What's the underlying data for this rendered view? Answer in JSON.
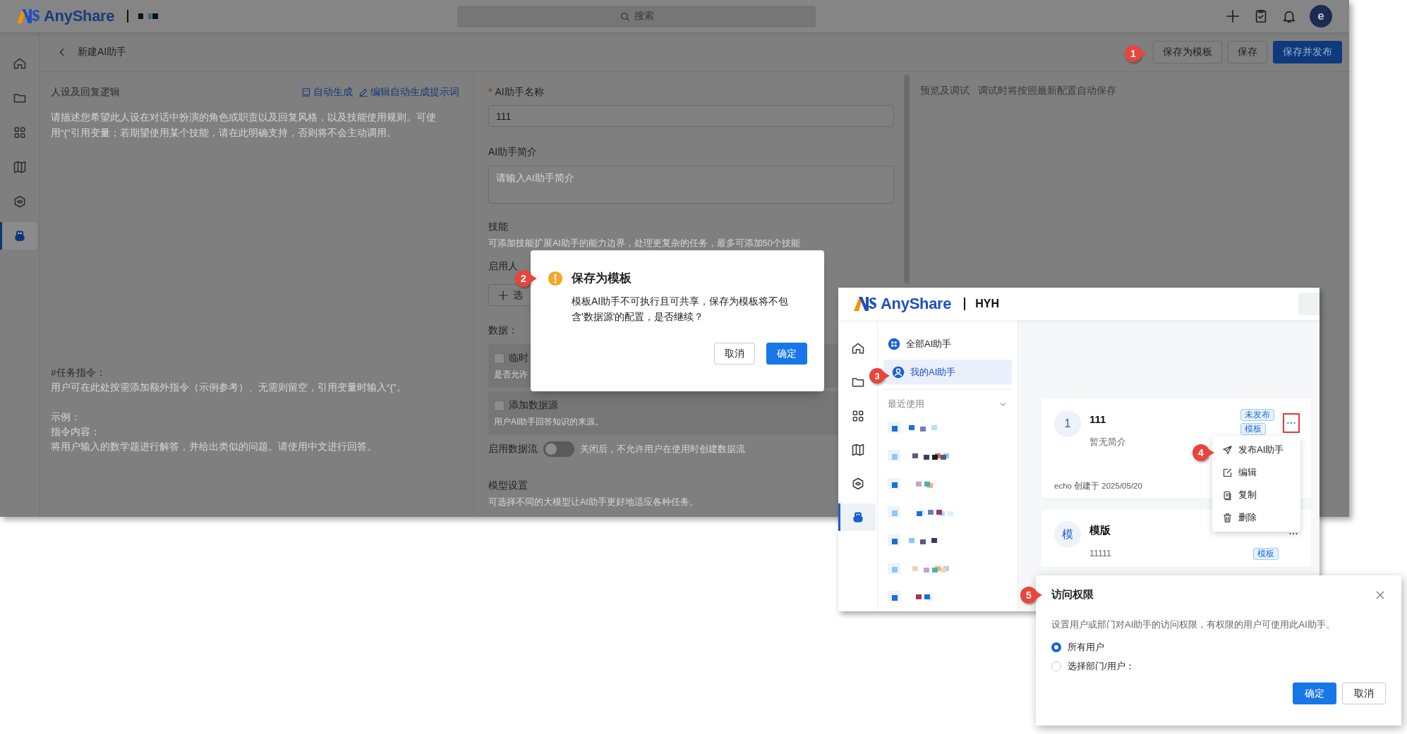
{
  "main_window": {
    "header": {
      "brand": "AnyShare",
      "search": {
        "placeholder": "搜索"
      },
      "avatar": "e"
    },
    "sidebar": [
      {
        "selected": false
      },
      {
        "selected": false
      },
      {
        "selected": false
      },
      {
        "selected": false
      },
      {
        "selected": false
      },
      {
        "selected": true
      }
    ],
    "page_title": "新建AI助手",
    "actions": [
      {
        "label": "保存为模板",
        "primary": false
      },
      {
        "label": "保存",
        "primary": false
      },
      {
        "label": "保存并发布",
        "primary": true
      }
    ],
    "persona": {
      "title": "人设及回复逻辑",
      "links": [
        "自动生成",
        "编辑自动生成提示词"
      ],
      "placeholder": "请描述您希望此人设在对话中扮演的角色或职责以及回复风格，以及技能使用规则。可使用“{”引用变量；若期望使用某个技能，请在此明确支持，否则将不会主动调用。",
      "task_lines": [
        "#任务指令：",
        "用户可在此处按需添加额外指令（示例参考）、无需则留空，引用变量时输入“{”。",
        "示例：",
        "指令内容：",
        "将用户输入的数学题进行解答，并给出类似的问题。请使用中文进行回答。"
      ]
    },
    "form": {
      "name": {
        "label": "AI助手名称",
        "required_mark": "*",
        "value": "111"
      },
      "intro": {
        "label": "AI助手简介",
        "placeholder": "请输入AI助手简介"
      },
      "skills": {
        "label": "技能",
        "hint": "可添加技能扩展AI助手的能力边界，处理更复杂的任务，最多可添加50个技能"
      },
      "human": {
        "label": "启用人",
        "button": "选"
      },
      "data": {
        "label": "数据：",
        "options": [
          {
            "label": "临时",
            "hint": "是否允许",
            "checked": false
          },
          {
            "label": "添加数据源",
            "hint": "用户AI助手回答知识的来源。",
            "checked": false
          }
        ]
      },
      "dataflow": {
        "label": "启用数据流",
        "on": false,
        "hint": "关闭后，不允许用户在使用时创建数据流"
      },
      "model": {
        "label": "模型设置",
        "hint": "可选择不同的大模型让AI助手更好地适应各种任务。"
      }
    },
    "preview": {
      "title": "预览及调试",
      "note": "调试时将按照最新配置自动保存"
    }
  },
  "confirm_dialog": {
    "title": "保存为模板",
    "message": "模板AI助手不可执行且可共享，保存为模板将不包含'数据源'的配置，是否继续？",
    "buttons": [
      {
        "label": "取消",
        "primary": false
      },
      {
        "label": "确定",
        "primary": true
      }
    ]
  },
  "assistant_window": {
    "brand": "AnyShare",
    "org": "HYH",
    "sidebar": [
      {
        "selected": false
      },
      {
        "selected": false
      },
      {
        "selected": false
      },
      {
        "selected": false
      },
      {
        "selected": false
      },
      {
        "selected": true
      }
    ],
    "nav": [
      {
        "label": "全部AI助手",
        "selected": false
      },
      {
        "label": "我的AI助手",
        "selected": true
      }
    ],
    "recent": {
      "label": "最近使用",
      "expanded": true
    },
    "cards": [
      {
        "avatar": "1",
        "name": "111",
        "description": "暂无简介",
        "tags": [
          "未发布",
          "模板"
        ],
        "footer": "echo 创建于 2025/05/20",
        "highlighted": true
      },
      {
        "avatar": "模",
        "name": "模版",
        "description": "11111",
        "tags": [
          "模板"
        ],
        "highlighted": false
      }
    ],
    "menu": [
      "发布AI助手",
      "编辑",
      "复制",
      "删除"
    ]
  },
  "access_dialog": {
    "title": "访问权限",
    "description": "设置用户或部门对AI助手的访问权限，有权限的用户可使用此AI助手。",
    "options": [
      {
        "label": "所有用户",
        "selected": true
      },
      {
        "label": "选择部门/用户：",
        "selected": false
      }
    ],
    "buttons": [
      {
        "label": "确定",
        "primary": true
      },
      {
        "label": "取消",
        "primary": false
      }
    ]
  },
  "callouts": [
    "1",
    "2",
    "3",
    "4",
    "5"
  ]
}
